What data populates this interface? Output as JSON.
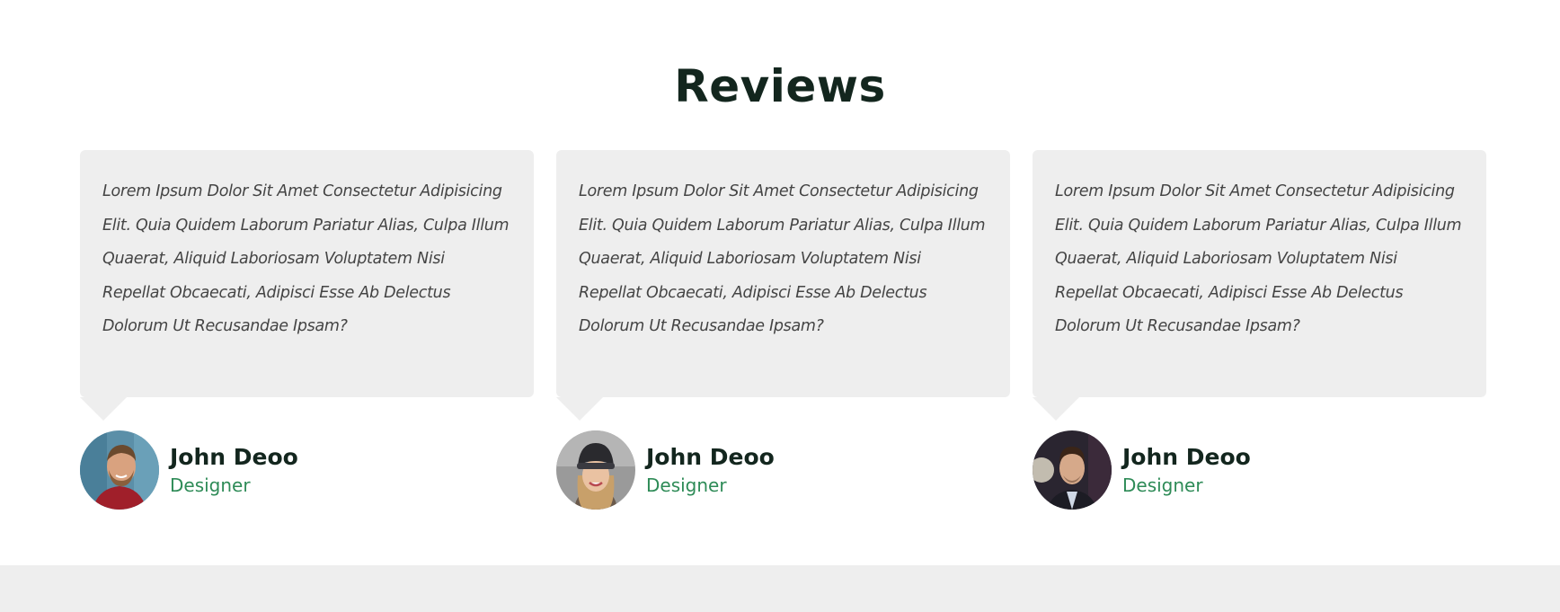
{
  "section": {
    "title": "Reviews"
  },
  "reviews": [
    {
      "text": "Lorem Ipsum Dolor Sit Amet Consectetur Adipisicing Elit. Quia Quidem Laborum Pariatur Alias, Culpa Illum Quaerat, Aliquid Laboriosam Voluptatem Nisi Repellat Obcaecati, Adipisci Esse Ab Delectus Dolorum Ut Recusandae Ipsam?",
      "name": "John Deoo",
      "role": "Designer",
      "avatar_icon": "man-with-beard-photo"
    },
    {
      "text": "Lorem Ipsum Dolor Sit Amet Consectetur Adipisicing Elit. Quia Quidem Laborum Pariatur Alias, Culpa Illum Quaerat, Aliquid Laboriosam Voluptatem Nisi Repellat Obcaecati, Adipisci Esse Ab Delectus Dolorum Ut Recusandae Ipsam?",
      "name": "John Deoo",
      "role": "Designer",
      "avatar_icon": "woman-in-beanie-photo"
    },
    {
      "text": "Lorem Ipsum Dolor Sit Amet Consectetur Adipisicing Elit. Quia Quidem Laborum Pariatur Alias, Culpa Illum Quaerat, Aliquid Laboriosam Voluptatem Nisi Repellat Obcaecati, Adipisci Esse Ab Delectus Dolorum Ut Recusandae Ipsam?",
      "name": "John Deoo",
      "role": "Designer",
      "avatar_icon": "man-in-suit-photo"
    }
  ],
  "colors": {
    "title": "#13261e",
    "card_background": "#eeeeee",
    "role_text": "#2e8b57",
    "footer_band": "#eeeeee"
  }
}
